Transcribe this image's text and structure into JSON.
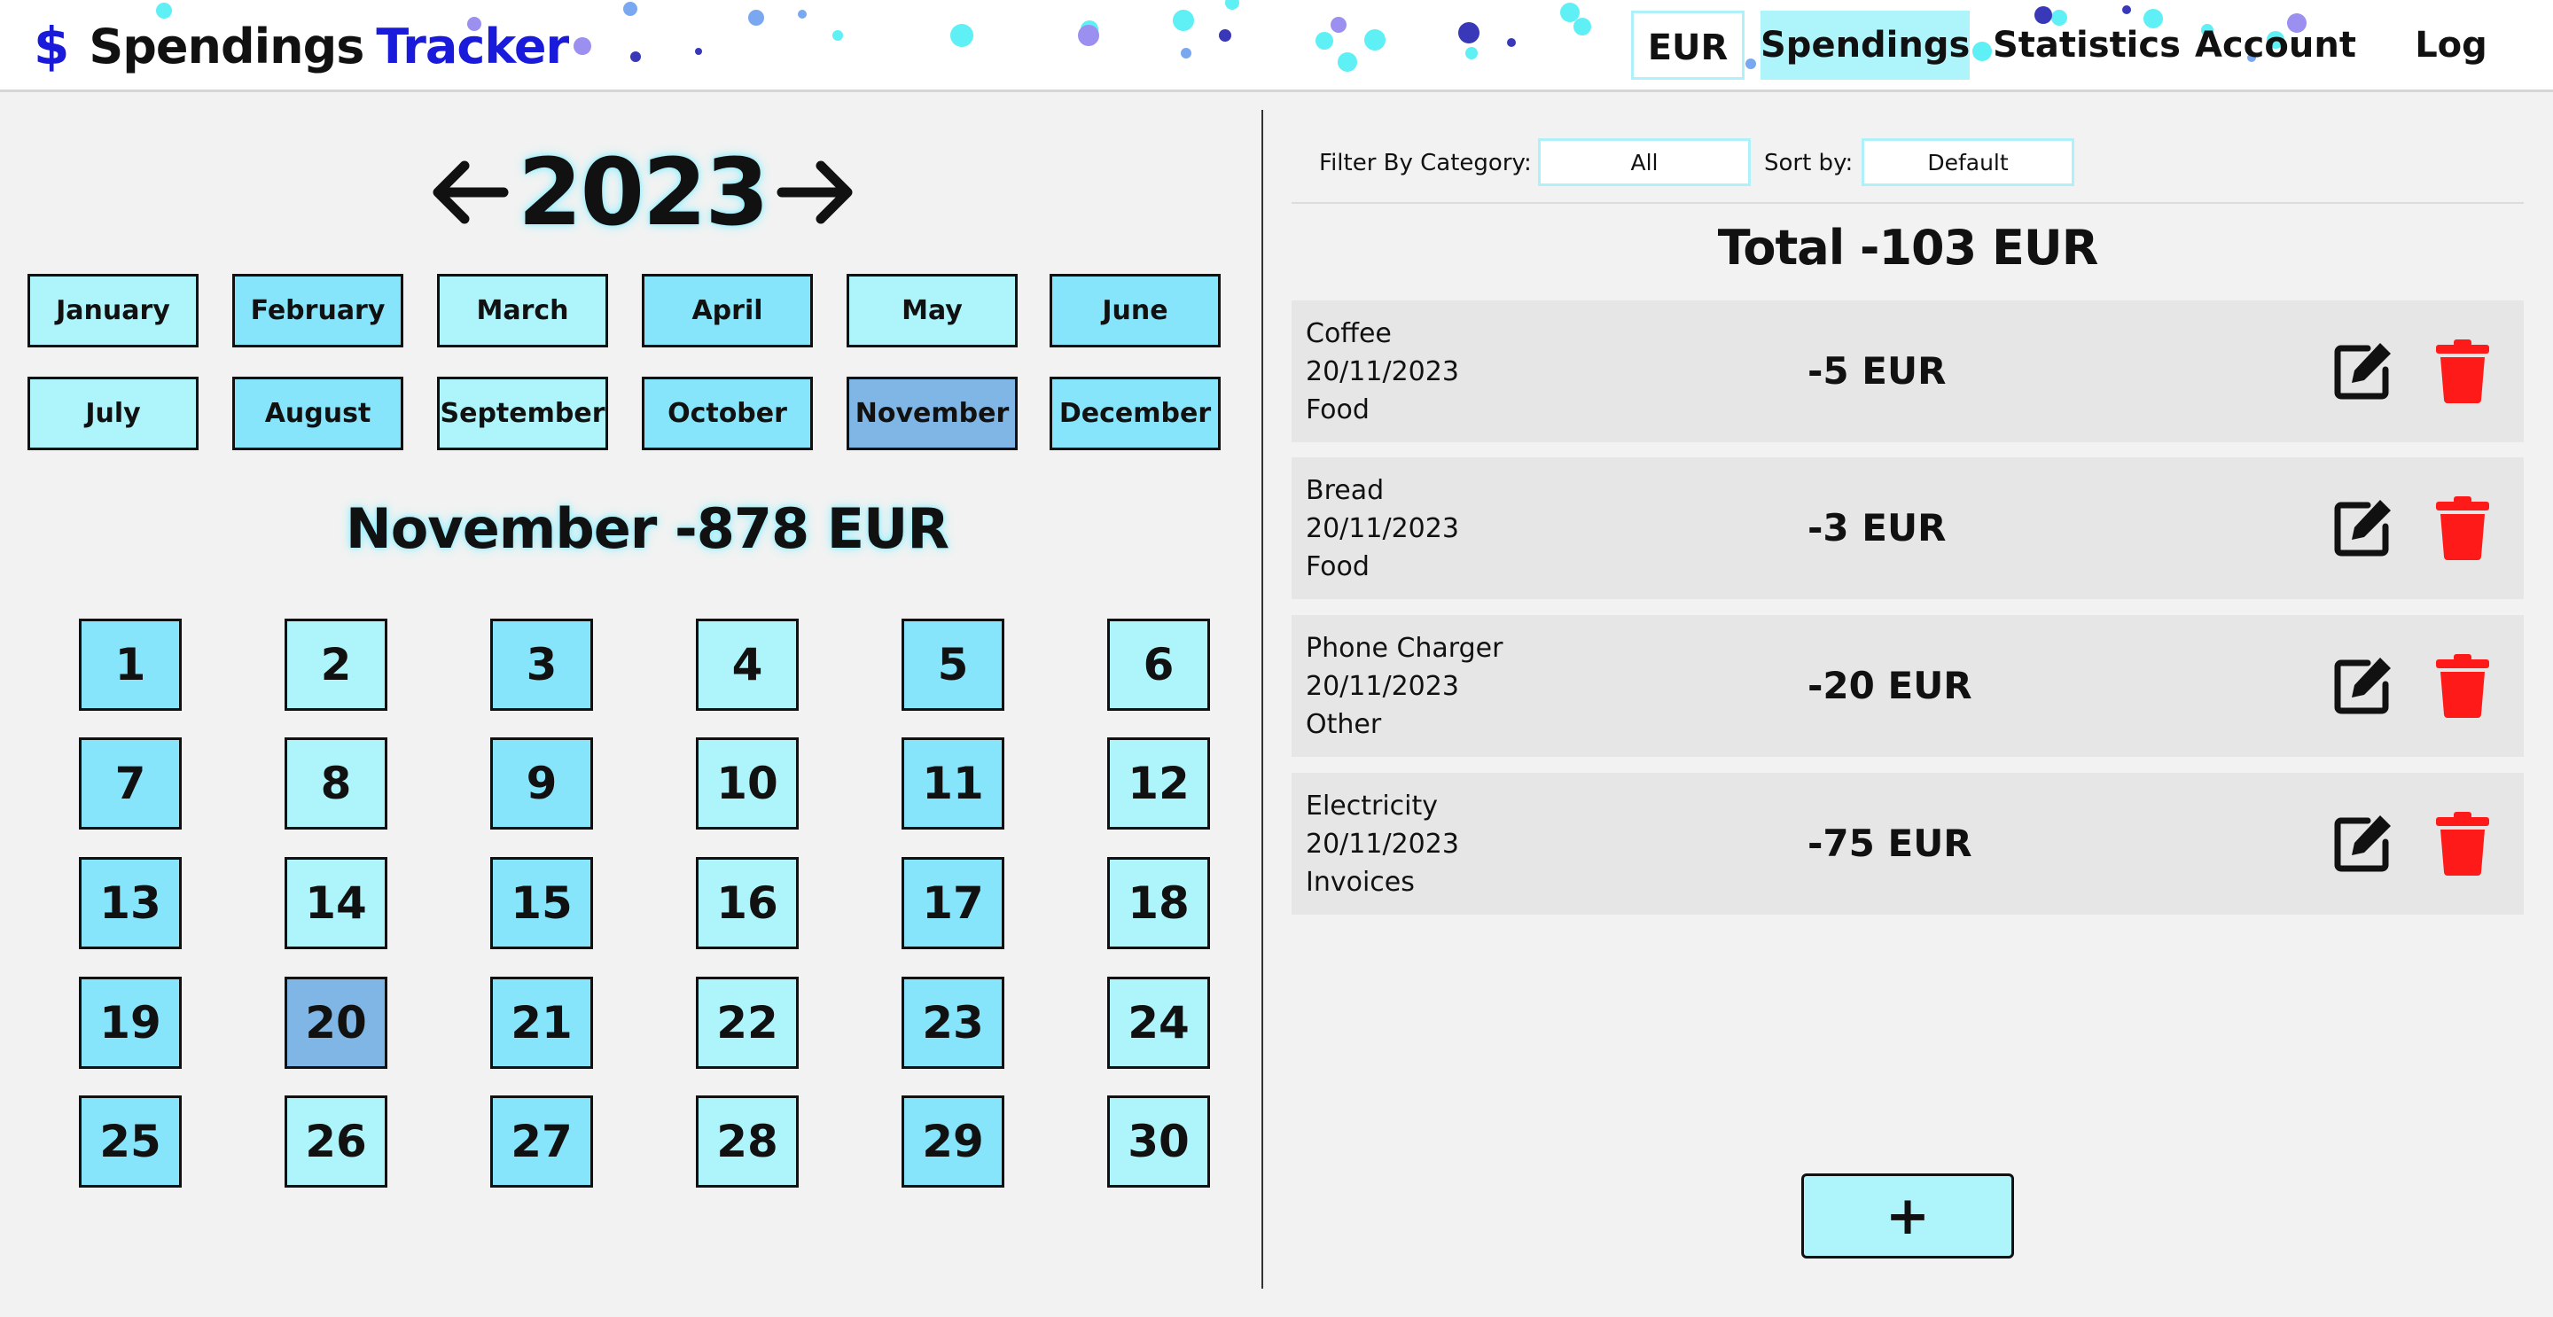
{
  "navbar": {
    "brand_symbol": "$",
    "brand_text_1": "Spendings",
    "brand_text_2": "Tracker",
    "currency": "EUR",
    "items": [
      "Spendings",
      "Statistics",
      "Account",
      "Log Out"
    ],
    "active": "Spendings"
  },
  "calendar": {
    "year": "2023",
    "months": [
      "January",
      "February",
      "March",
      "April",
      "May",
      "June",
      "July",
      "August",
      "September",
      "October",
      "November",
      "December"
    ],
    "selected_month": "November",
    "month_total": "November -878 EUR",
    "days": [
      "1",
      "2",
      "3",
      "4",
      "5",
      "6",
      "7",
      "8",
      "9",
      "10",
      "11",
      "12",
      "13",
      "14",
      "15",
      "16",
      "17",
      "18",
      "19",
      "20",
      "21",
      "22",
      "23",
      "24",
      "25",
      "26",
      "27",
      "28",
      "29",
      "30"
    ],
    "selected_day": "20"
  },
  "filters": {
    "category_label": "Filter By Category:",
    "category_value": "All",
    "sort_label": "Sort by:",
    "sort_value": "Default"
  },
  "spendings": {
    "total": "Total -103 EUR",
    "items": [
      {
        "name": "Coffee",
        "date": "20/11/2023",
        "category": "Food",
        "amount": "-5 EUR"
      },
      {
        "name": "Bread",
        "date": "20/11/2023",
        "category": "Food",
        "amount": "-3 EUR"
      },
      {
        "name": "Phone Charger",
        "date": "20/11/2023",
        "category": "Other",
        "amount": "-20 EUR"
      },
      {
        "name": "Electricity",
        "date": "20/11/2023",
        "category": "Invoices",
        "amount": "-75 EUR"
      }
    ],
    "add_label": "+"
  },
  "colors": {
    "brand_blue": "#1a1adb",
    "cell_light": "#aef4fb",
    "cell_mid": "#86e4fb",
    "cell_selected": "#7fb6e6",
    "delete_red": "#ff1a1a"
  },
  "icons": {
    "prev": "arrow-left-icon",
    "next": "arrow-right-icon",
    "edit": "edit-icon",
    "delete": "trash-icon"
  }
}
